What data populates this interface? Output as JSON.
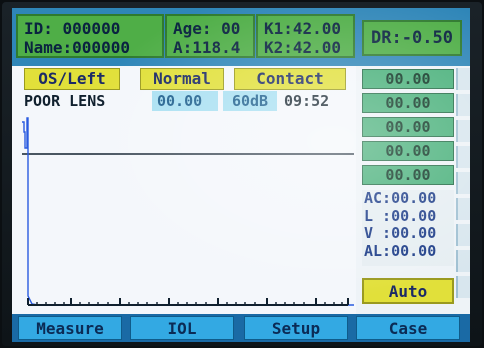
{
  "header": {
    "id_line": "ID:  000000",
    "name_line": "Name:000000",
    "age_line": "Age: 00",
    "a_line": "A:118.4",
    "k1_line": "K1:42.00",
    "k2_line": "K2:42.00",
    "dr_line": "DR:-0.50"
  },
  "labels": {
    "eye": "OS/Left",
    "mode": "Normal",
    "contact": "Contact"
  },
  "status": {
    "text": "POOR LENS",
    "gain_value": "00.00",
    "gain": "60dB",
    "time": "09:52"
  },
  "readings": [
    "00.00",
    "00.00",
    "00.00",
    "00.00",
    "00.00"
  ],
  "measurements": {
    "ac": "AC:00.00",
    "l": "L  :00.00",
    "v": "V  :00.00",
    "al": "AL:00.00"
  },
  "auto_label": "Auto",
  "menu": [
    "Measure",
    "IOL",
    "Setup",
    "Case"
  ],
  "colors": {
    "header_green": "#4fae47",
    "label_yellow": "#e1e03a",
    "reading_green": "#48b07a",
    "menu_blue": "#33a9e3",
    "trace_blue": "#2a5be0"
  }
}
